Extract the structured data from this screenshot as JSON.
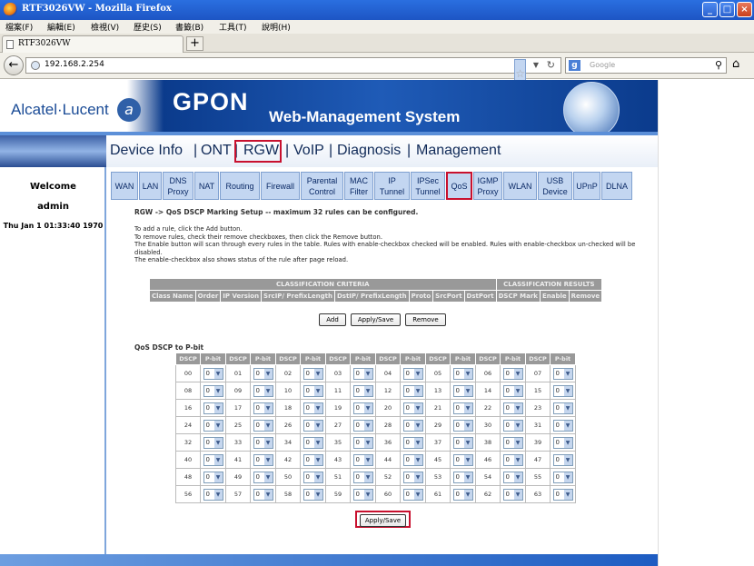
{
  "window": {
    "title": "RTF3026VW - Mozilla Firefox"
  },
  "menubar": [
    "檔案(F)",
    "編輯(E)",
    "檢視(V)",
    "歷史(S)",
    "書籤(B)",
    "工具(T)",
    "說明(H)"
  ],
  "tab": {
    "title": "RTF3026VW"
  },
  "address": {
    "url": "192.168.2.254"
  },
  "search": {
    "engine": "g",
    "placeholder": "Google"
  },
  "banner": {
    "brand": "Alcatel·Lucent",
    "product": "GPON",
    "subtitle": "Web-Management System"
  },
  "mainmenu": [
    "Device Info",
    "ONT",
    "RGW",
    "VoIP",
    "Diagnosis",
    "Management"
  ],
  "sidebar": {
    "welcome": "Welcome",
    "user": "admin",
    "datetime": "Thu Jan 1 01:33:40 1970"
  },
  "subtabs": [
    "WAN",
    "LAN",
    "DNS Proxy",
    "NAT",
    "Routing",
    "Firewall",
    "Parental Control",
    "MAC Filter",
    "IP Tunnel",
    "IPSec Tunnel",
    "QoS",
    "IGMP Proxy",
    "WLAN",
    "USB Device",
    "UPnP",
    "DLNA"
  ],
  "content": {
    "heading": "RGW -> QoS DSCP Marking Setup -- maximum 32 rules can be configured.",
    "help": [
      "To add a rule, click the Add button.",
      "To remove rules, check their remove checkboxes, then click the Remove button.",
      "The Enable button will scan through every rules in the table. Rules with enable-checkbox checked will be enabled. Rules with enable-checkbox un-checked will be",
      "disabled.",
      "The enable-checkbox also shows status of the rule after page reload."
    ],
    "rules_table": {
      "group_headers": [
        "CLASSIFICATION CRITERIA",
        "CLASSIFICATION RESULTS"
      ],
      "columns": [
        "Class Name",
        "Order",
        "IP Version",
        "SrcIP/ PrefixLength",
        "DstIP/ PrefixLength",
        "Proto",
        "SrcPort",
        "DstPort",
        "DSCP Mark",
        "Enable",
        "Remove"
      ]
    },
    "buttons": {
      "add": "Add",
      "apply": "Apply/Save",
      "remove": "Remove",
      "apply_bottom": "Apply/Save"
    },
    "dscp_title": "QoS DSCP to P-bit",
    "dscp_headers": [
      "DSCP",
      "P-bit"
    ],
    "dscp_rows": [
      [
        "00",
        "01",
        "02",
        "03",
        "04",
        "05",
        "06",
        "07"
      ],
      [
        "08",
        "09",
        "10",
        "11",
        "12",
        "13",
        "14",
        "15"
      ],
      [
        "16",
        "17",
        "18",
        "19",
        "20",
        "21",
        "22",
        "23"
      ],
      [
        "24",
        "25",
        "26",
        "27",
        "28",
        "29",
        "30",
        "31"
      ],
      [
        "32",
        "33",
        "34",
        "35",
        "36",
        "37",
        "38",
        "39"
      ],
      [
        "40",
        "41",
        "42",
        "43",
        "44",
        "45",
        "46",
        "47"
      ],
      [
        "48",
        "49",
        "50",
        "51",
        "52",
        "53",
        "54",
        "55"
      ],
      [
        "56",
        "57",
        "58",
        "59",
        "60",
        "61",
        "62",
        "63"
      ]
    ],
    "pbit_value": "0"
  }
}
